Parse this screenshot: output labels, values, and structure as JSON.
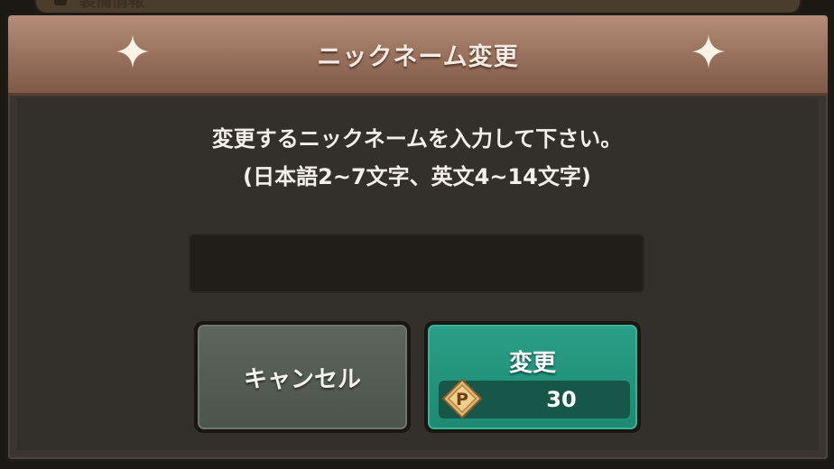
{
  "background": {
    "top_bar_label": "装備情報"
  },
  "dialog": {
    "title": "ニックネーム変更",
    "instruction_line1": "変更するニックネームを入力して下さい。",
    "instruction_line2": "(日本語2~7文字、英文4~14文字)",
    "input": {
      "value": "",
      "placeholder": ""
    },
    "buttons": {
      "cancel_label": "キャンセル",
      "change_label": "変更",
      "cost": "30",
      "currency_icon": "p-coin-icon",
      "currency_letter": "P"
    }
  },
  "colors": {
    "header": "#9c7561",
    "change_button": "#1d8a73",
    "cancel_button": "#4c544b",
    "panel": "#332f2a"
  }
}
